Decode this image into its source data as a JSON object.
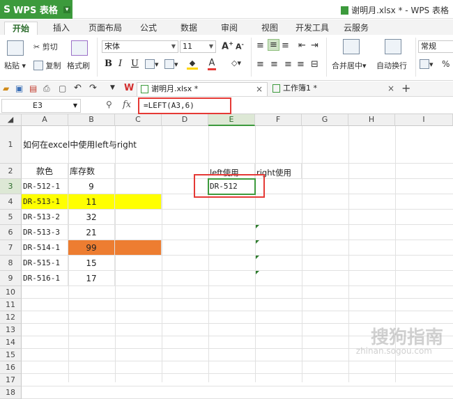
{
  "app": {
    "name": "WPS 表格",
    "logo": "S"
  },
  "window_title": "谢明月.xlsx * - WPS 表格",
  "ribbon_tabs": [
    "开始",
    "插入",
    "页面布局",
    "公式",
    "数据",
    "审阅",
    "视图",
    "开发工具",
    "云服务"
  ],
  "ribbon": {
    "cut": "剪切",
    "paste": "粘贴",
    "copy": "复制",
    "format_painter": "格式刷",
    "font_name": "宋体",
    "font_size": "11",
    "merge_center": "合并居中",
    "wrap_text": "自动换行",
    "number_format": "常规",
    "percent": "%"
  },
  "doc_tabs": [
    {
      "label": "谢明月.xlsx *",
      "active": true
    },
    {
      "label": "工作簿1 *",
      "active": false
    }
  ],
  "name_box": "E3",
  "formula": "=LEFT(A3,6)",
  "columns": [
    "A",
    "B",
    "C",
    "D",
    "E",
    "F",
    "G",
    "H",
    "I"
  ],
  "rows": [
    "1",
    "2",
    "3",
    "4",
    "5",
    "6",
    "7",
    "8",
    "9",
    "10",
    "11",
    "12",
    "13",
    "14",
    "15",
    "16",
    "17",
    "18"
  ],
  "cells": {
    "A1": "如何在excel中使用left与right",
    "A2": "款色",
    "B2": "库存数",
    "E2": "left使用",
    "F2": "right使用",
    "A3": "DR-512-1",
    "B3": "9",
    "E3": "DR-512",
    "A4": "DR-513-1",
    "B4": "11",
    "A5": "DR-513-2",
    "B5": "32",
    "A6": "DR-513-3",
    "B6": "21",
    "A7": "DR-514-1",
    "B7": "99",
    "A8": "DR-515-1",
    "B8": "15",
    "A9": "DR-516-1",
    "B9": "17"
  },
  "highlight_colors": {
    "row4": "#ffff00",
    "row7": "#ed7d31",
    "accent": "#3c9a3c",
    "annotation": "#e53935"
  },
  "watermark": {
    "main": "搜狗指南",
    "sub": "zhinan.sogou.com"
  }
}
